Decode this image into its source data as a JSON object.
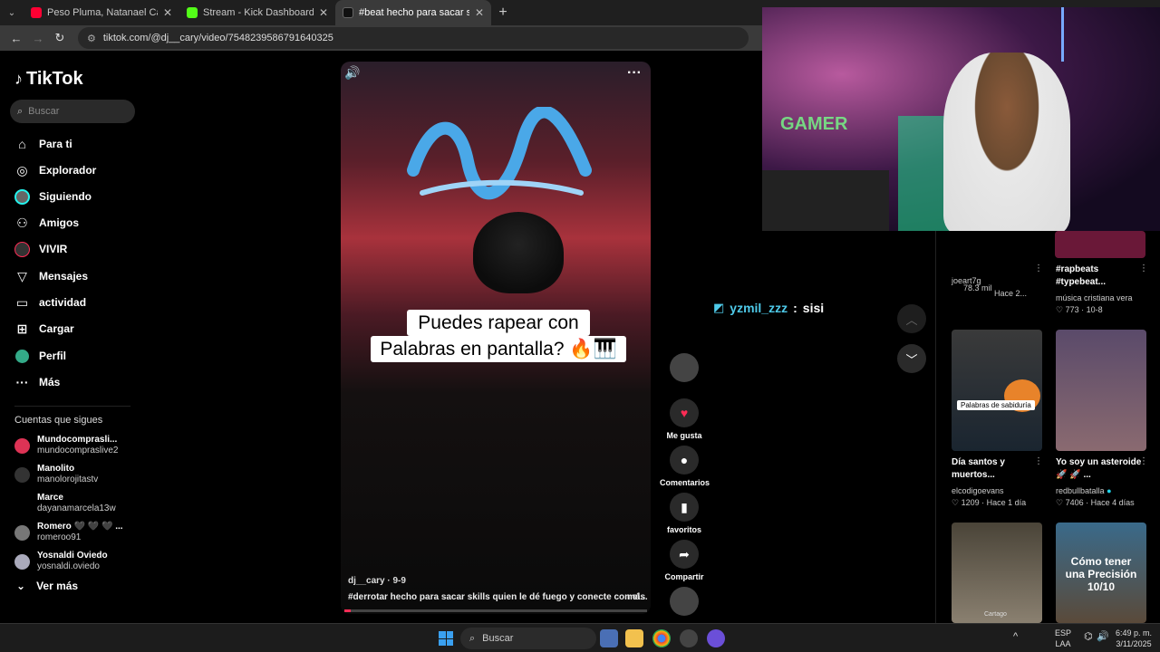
{
  "tabs": [
    {
      "title": "Peso Pluma, Natanael Cano - Pl",
      "favicon_color": "#ff0033"
    },
    {
      "title": "Stream - Kick Dashboard",
      "favicon_color": "#53fc18"
    },
    {
      "title": "#beat hecho para sacar skills q",
      "favicon_color": "#111111"
    }
  ],
  "new_tab": "+",
  "url": "tiktok.com/@dj__cary/video/7548239586791640325",
  "sidebar": {
    "logo": "TikTok",
    "search_placeholder": "Buscar",
    "nav": [
      {
        "label": "Para ti",
        "icon": "⌂"
      },
      {
        "label": "Explorador",
        "icon": "◎"
      },
      {
        "label": "Siguiendo",
        "icon": "●"
      },
      {
        "label": "Amigos",
        "icon": "👥"
      },
      {
        "label": "VIVIR",
        "icon": "●"
      },
      {
        "label": "Mensajes",
        "icon": "▽"
      },
      {
        "label": "actividad",
        "icon": "▭"
      },
      {
        "label": "Cargar",
        "icon": "⊞"
      },
      {
        "label": "Perfil",
        "icon": "●"
      },
      {
        "label": "Más",
        "icon": "···"
      }
    ],
    "following_title": "Cuentas que sigues",
    "following": [
      {
        "name": "Mundocomprasli...",
        "handle": "mundocompraslive2"
      },
      {
        "name": "Manolito",
        "handle": "manolorojitastv"
      },
      {
        "name": "Marce",
        "handle": "dayanamarcela13w"
      },
      {
        "name": "Romero 🖤 🖤 🖤 ...",
        "handle": "romeroo91"
      },
      {
        "name": "Yosnaldi Oviedo",
        "handle": "yosnaldi.oviedo"
      }
    ],
    "see_more": "Ver más"
  },
  "video": {
    "caption_line1": "Puedes rapear con",
    "caption_line2": "Palabras en pantalla? 🔥🎹",
    "user": "dj__cary · 9-9",
    "description": "#derrotar hecho para sacar skills quien le dé fuego y conecte con el...",
    "more": "más",
    "progress": 0.02
  },
  "actions": [
    {
      "label": "Me gusta",
      "icon": "♥"
    },
    {
      "label": "Comentarios",
      "icon": "💬"
    },
    {
      "label": "favoritos",
      "icon": "🔖"
    },
    {
      "label": "Compartir",
      "icon": "➦"
    }
  ],
  "chat": {
    "user": "yzmil_zzz",
    "sep": ":",
    "message": "sisi"
  },
  "recs": [
    {
      "title": "",
      "user": "joeart7g",
      "extra": "78.3 mil",
      "meta": "Hace 2..."
    },
    {
      "title": "#rapbeats #typebeat...",
      "user": "música cristiana vera",
      "meta": "♡ 773 · 10-8"
    },
    {
      "title": "Día santos y muertos...",
      "user": "elcodigoevans",
      "meta": "♡ 1209 · Hace 1 día",
      "thumb_label": "Palabras de sabiduría"
    },
    {
      "title": "Yo soy un asteroide 🚀 🚀 ...",
      "user": "redbullbatalla",
      "meta": "♡ 7406 · Hace 4 días"
    },
    {
      "thumb_label": "Cartago"
    },
    {
      "thumb_label": "Cómo tener una Precisión 10/10"
    }
  ],
  "taskbar": {
    "search": "Buscar",
    "lang": "ESP LAA",
    "time": "6:49 p. m.",
    "date": "3/11/2025"
  },
  "colors": {
    "accent": "#fe2c55",
    "chat_user": "#4ec9e8",
    "verified": "#20d5ec"
  }
}
